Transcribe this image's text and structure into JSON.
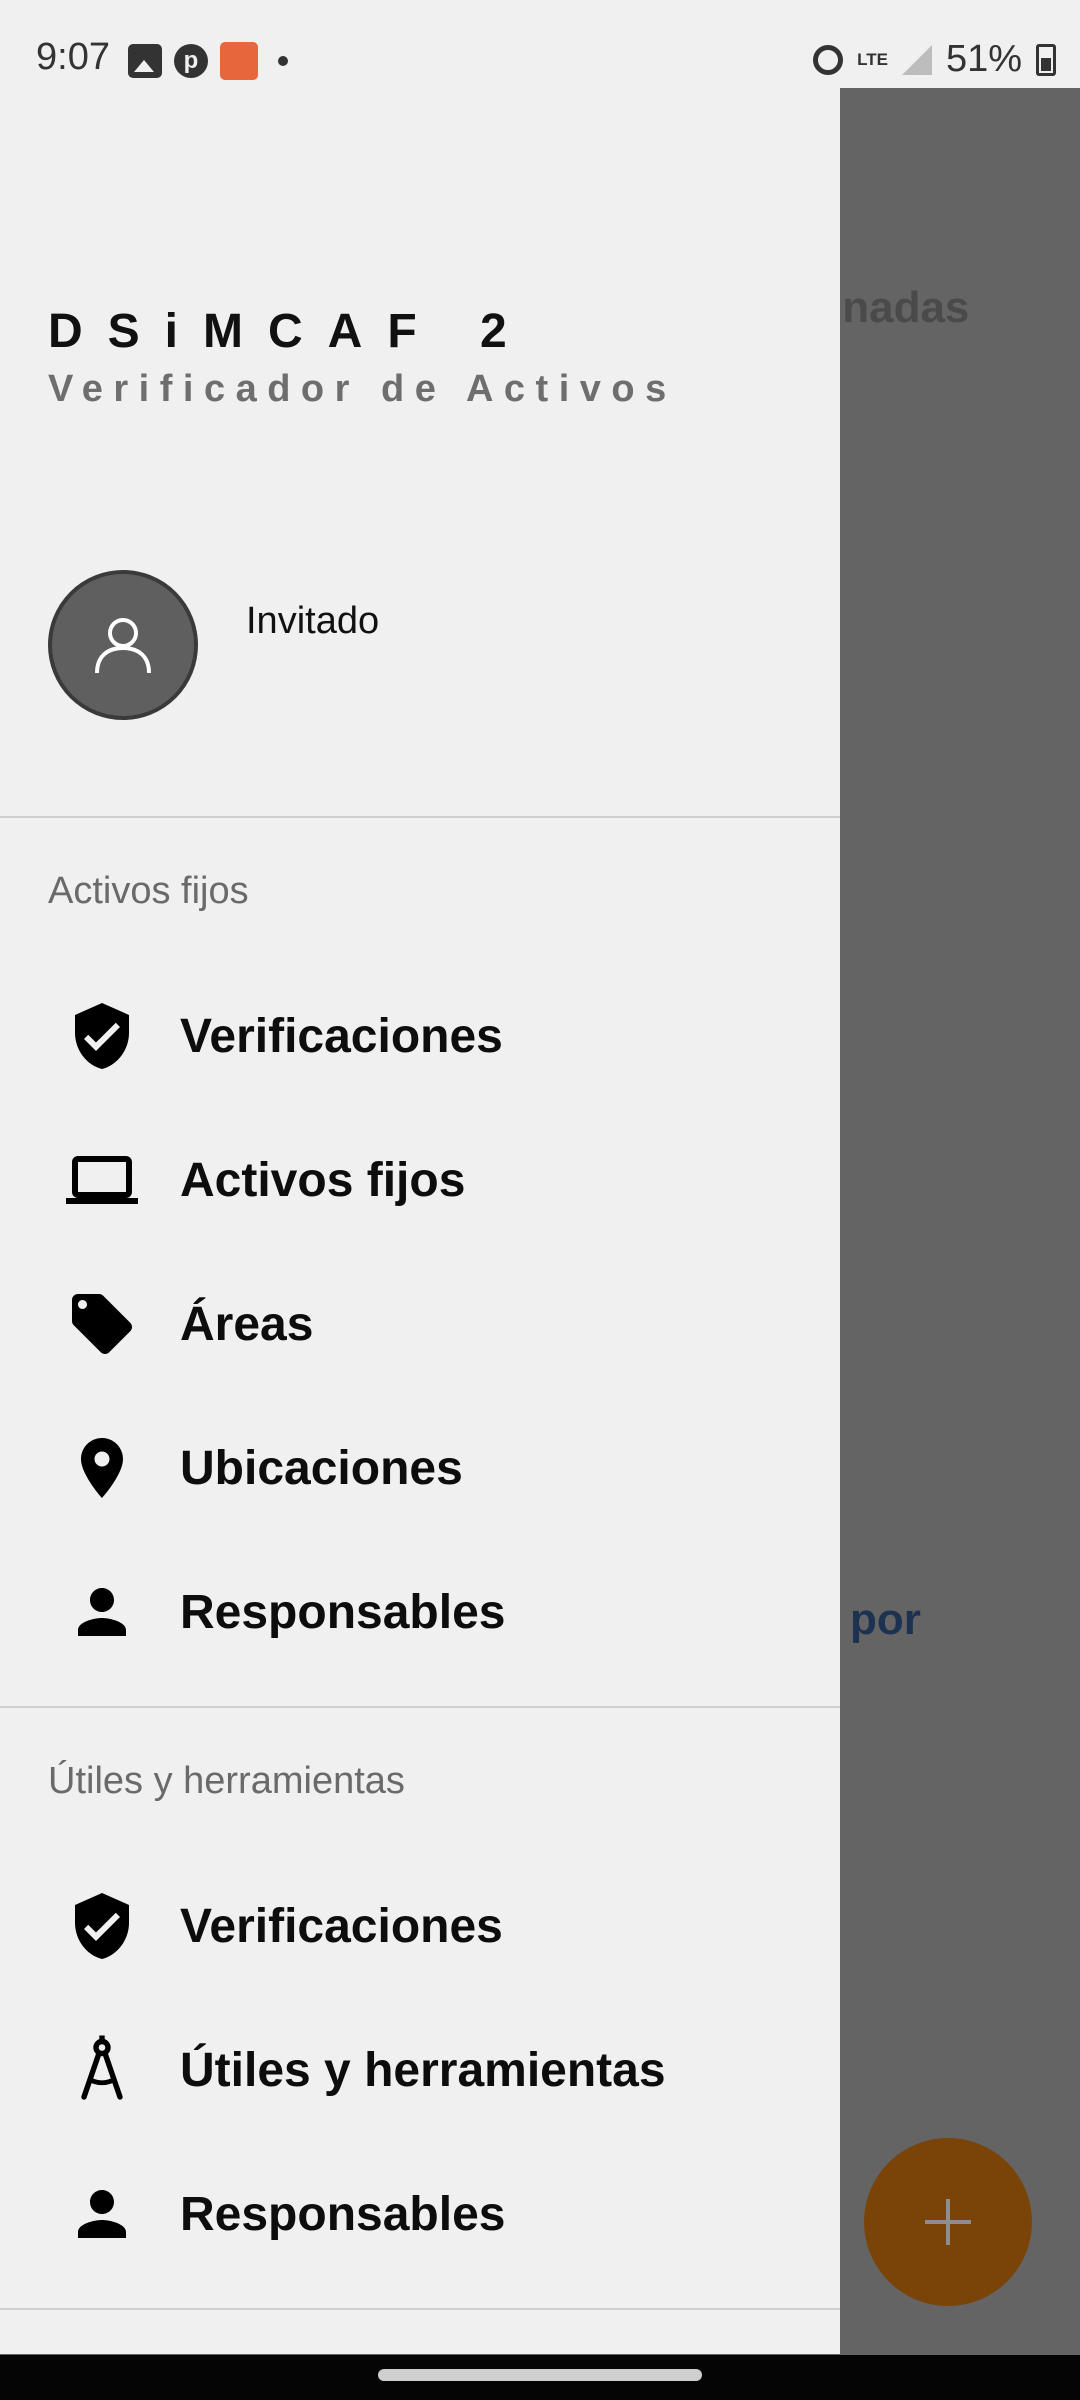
{
  "status_bar": {
    "time": "9:07",
    "network": "LTE",
    "battery": "51%",
    "left_icons": [
      "gallery-icon",
      "pinterest-icon",
      "app-notification-icon",
      "notification-dot"
    ],
    "right_icons": [
      "alarm-icon",
      "lte-icon",
      "signal-icon",
      "battery-icon"
    ]
  },
  "background": {
    "partial_text_1": "inadas",
    "partial_text_2": "por",
    "fab_icon": "plus-icon",
    "fab_color": "#7a4308"
  },
  "drawer": {
    "app_title": "DSiMCAF 2",
    "app_subtitle": "Verificador de Activos",
    "user": {
      "avatar_icon": "person-outline-icon",
      "name": "Invitado"
    },
    "sections": [
      {
        "title": "Activos fijos",
        "items": [
          {
            "icon": "verified-shield-icon",
            "label": "Verificaciones"
          },
          {
            "icon": "laptop-icon",
            "label": "Activos fijos"
          },
          {
            "icon": "tag-icon",
            "label": "Áreas"
          },
          {
            "icon": "location-pin-icon",
            "label": "Ubicaciones"
          },
          {
            "icon": "person-icon",
            "label": "Responsables"
          }
        ]
      },
      {
        "title": "Útiles y herramientas",
        "items": [
          {
            "icon": "verified-shield-icon",
            "label": "Verificaciones"
          },
          {
            "icon": "compass-icon",
            "label": "Útiles y herramientas"
          },
          {
            "icon": "person-icon",
            "label": "Responsables"
          }
        ]
      }
    ]
  }
}
